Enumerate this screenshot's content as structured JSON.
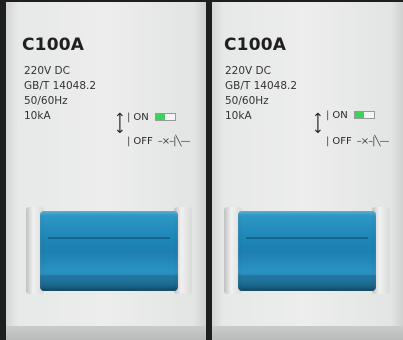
{
  "breakers": [
    {
      "model": "C100A",
      "specs": [
        "220V DC",
        "GB/T 14048.2",
        "50/60Hz",
        "10kA"
      ],
      "on_label": "ON",
      "off_label": "OFF",
      "state": "ON"
    },
    {
      "model": "C100A",
      "specs": [
        "220V DC",
        "GB/T 14048.2",
        "50/60Hz",
        "10kA"
      ],
      "on_label": "ON",
      "off_label": "OFF",
      "state": "ON"
    }
  ],
  "colors": {
    "handle": "#1e86b7",
    "on_indicator": "#3fd25a",
    "housing": "#eceded"
  },
  "icons": {
    "up_down": "up-down-arrow-icon",
    "off_symbol": "switch-off-symbol-icon"
  }
}
